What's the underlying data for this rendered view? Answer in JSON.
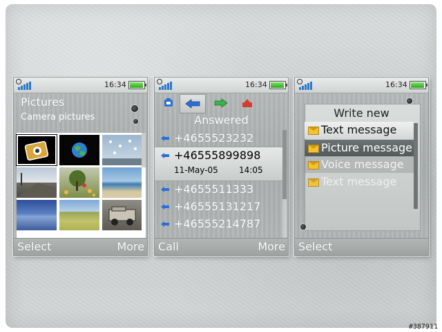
{
  "watermark": "#387911",
  "status": {
    "time": "16:34"
  },
  "screen1": {
    "title": "Pictures",
    "subtitle": "Camera pictures",
    "thumbnails": [
      {
        "name": "camera-folder"
      },
      {
        "name": "globe"
      },
      {
        "name": "sky-birds"
      },
      {
        "name": "railway"
      },
      {
        "name": "flowers"
      },
      {
        "name": "beach"
      },
      {
        "name": "lake"
      },
      {
        "name": "field"
      },
      {
        "name": "jeep"
      }
    ],
    "softkeys": {
      "left": "Select",
      "right": "More"
    }
  },
  "screen2": {
    "header": "Answered",
    "tabs": [
      {
        "icon": "phone-icon"
      },
      {
        "icon": "incoming-arrow-icon"
      },
      {
        "icon": "outgoing-arrow-icon"
      },
      {
        "icon": "missed-call-icon"
      }
    ],
    "calls": [
      {
        "number": "+4655523232"
      },
      {
        "number": "+46555899898",
        "date": "11-May-05",
        "time": "14:05"
      },
      {
        "number": "+4655511333"
      },
      {
        "number": "+46555131217"
      },
      {
        "number": "+46555214787"
      }
    ],
    "softkeys": {
      "left": "Call",
      "right": "More"
    }
  },
  "screen3": {
    "title": "Write new",
    "items": [
      {
        "label": "Text message",
        "state": "highlighted"
      },
      {
        "label": "Picture message",
        "state": "normal"
      },
      {
        "label": "Voice message",
        "state": "dimmed"
      },
      {
        "label": "Text message",
        "state": "faint"
      }
    ],
    "softkeys": {
      "left": "Select"
    }
  },
  "colors": {
    "signal": "#2b78c9",
    "battery": "#2fa51e",
    "envelope": "#f2c230",
    "incoming": "#2b6fd6",
    "outgoing": "#39b34a",
    "missed": "#d63b2f"
  }
}
